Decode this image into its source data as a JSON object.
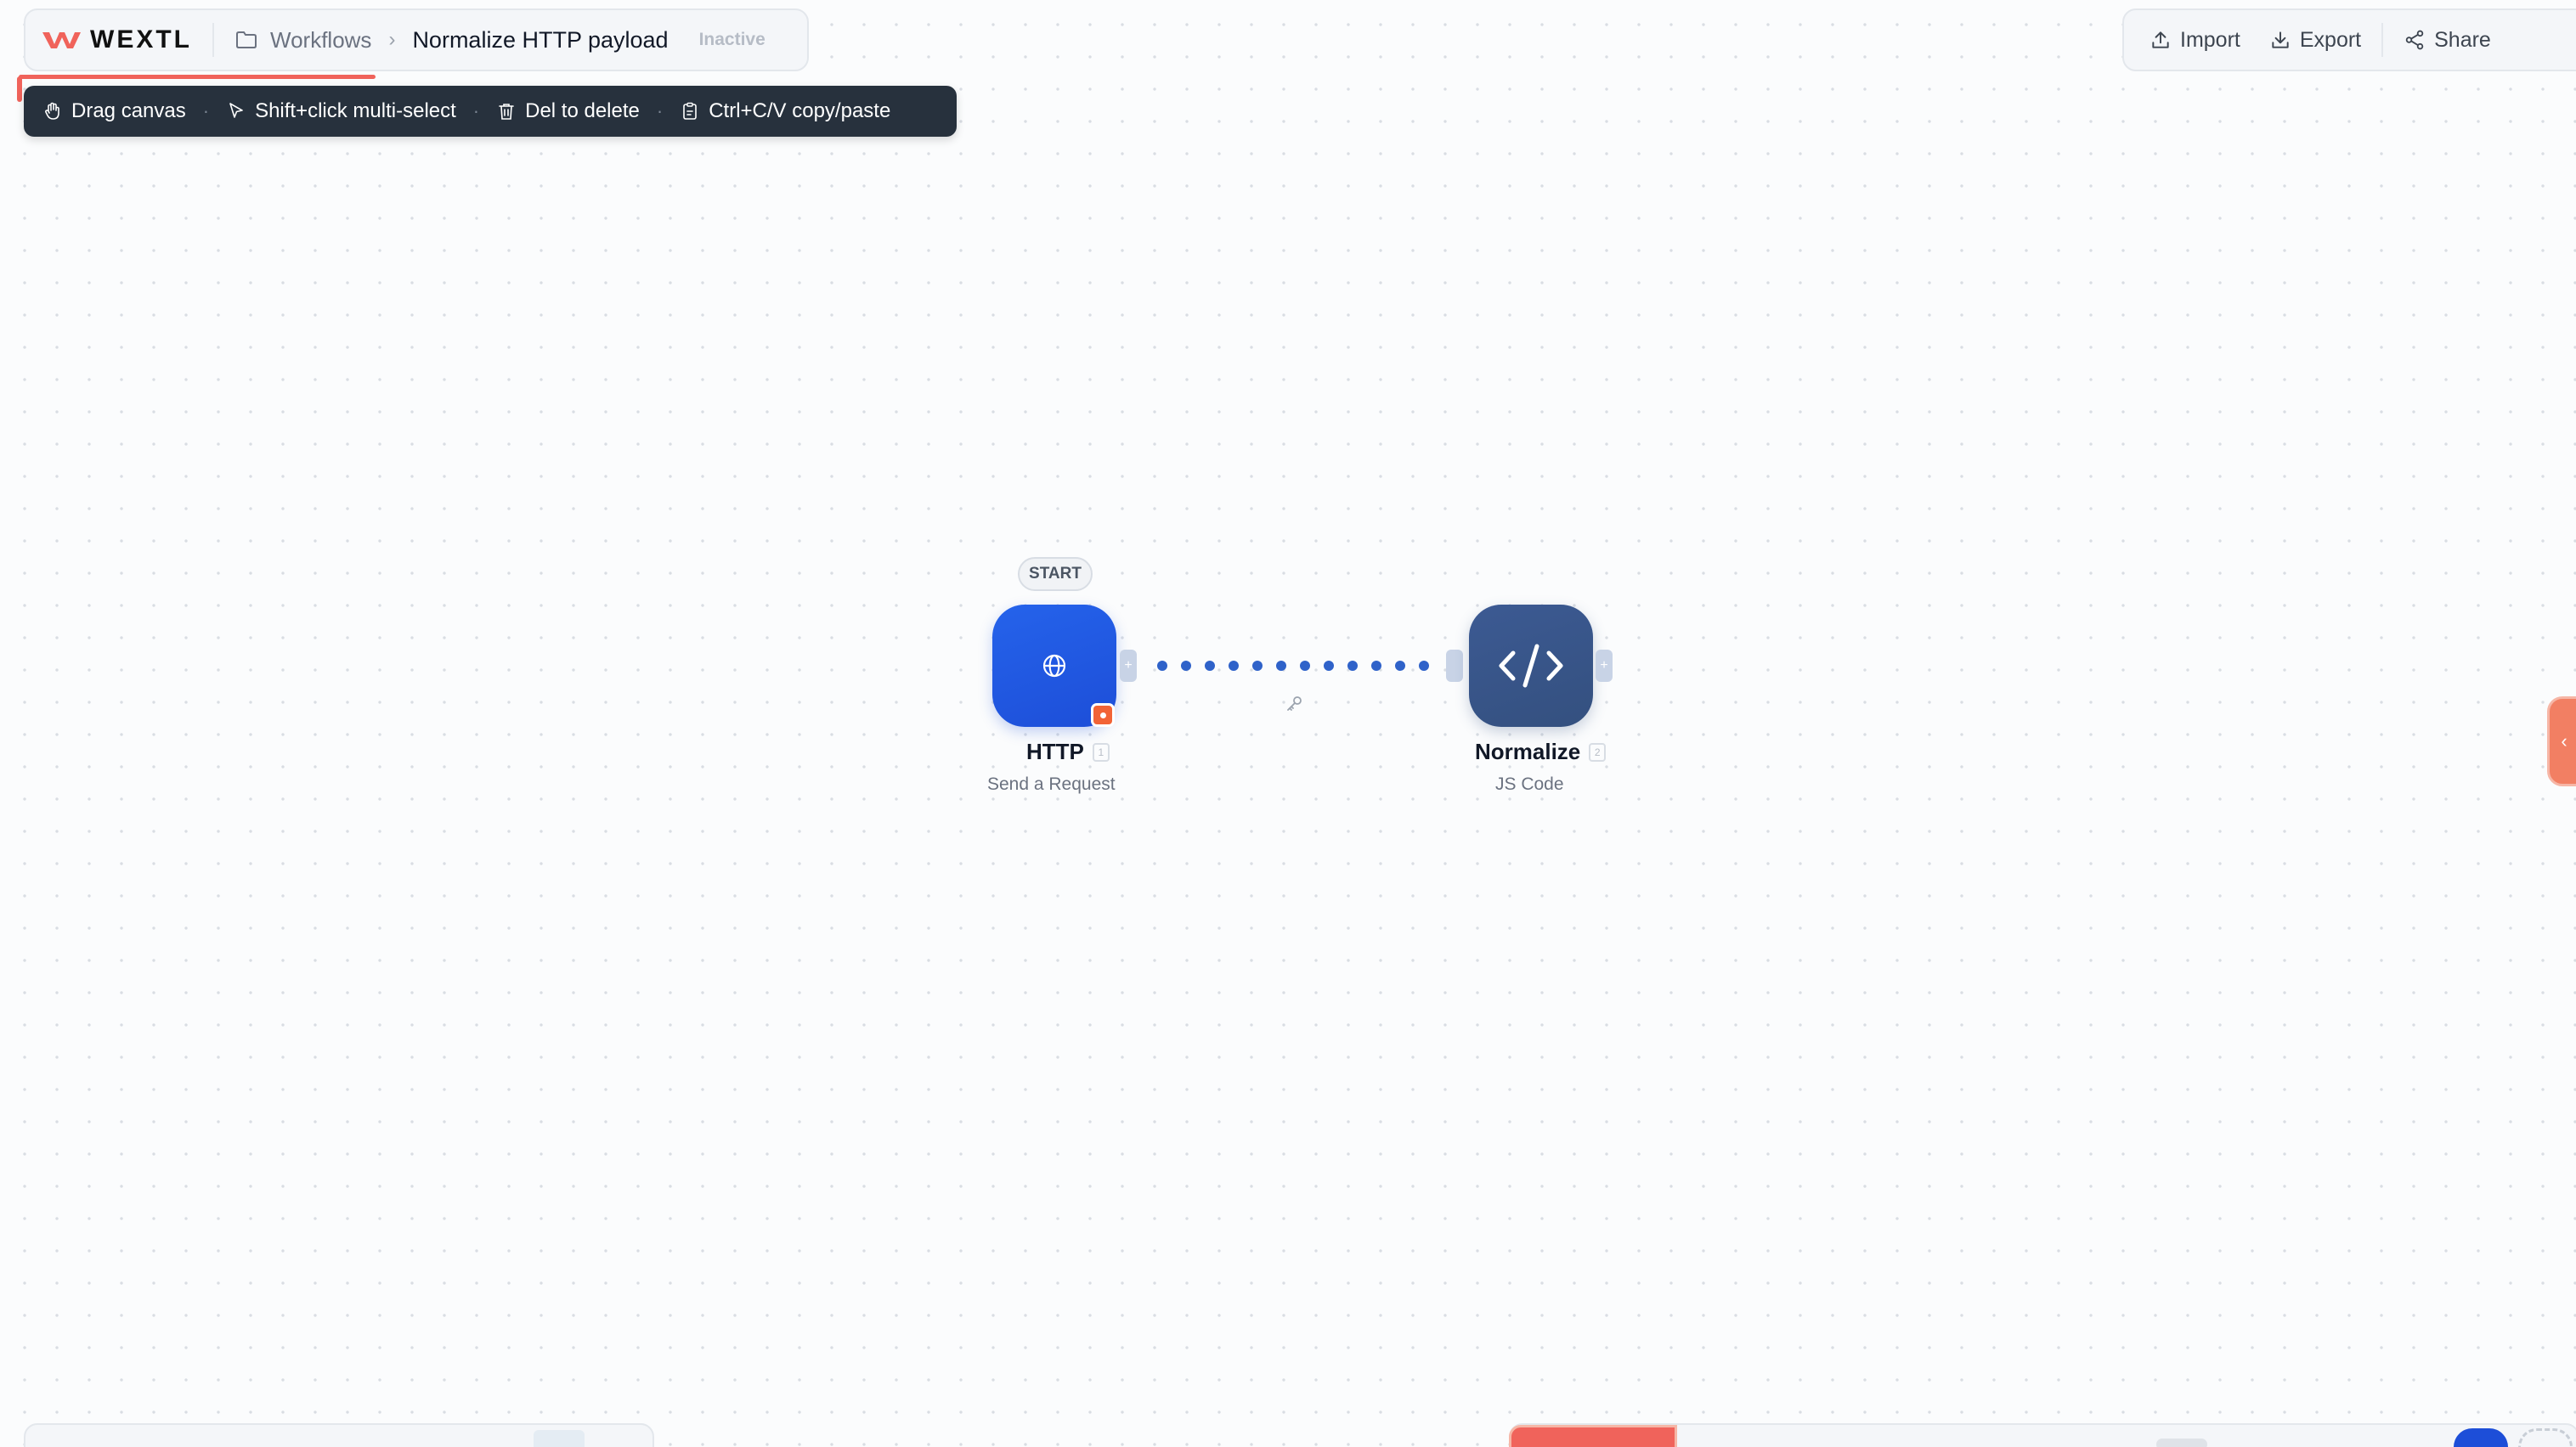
{
  "app": {
    "brand": "WEXTL"
  },
  "breadcrumb": {
    "section": "Workflows",
    "separator": "›",
    "title": "Normalize HTTP payload",
    "status": "Inactive"
  },
  "hints": [
    {
      "icon": "hand-icon",
      "label": "Drag canvas"
    },
    {
      "icon": "cursor-icon",
      "label": "Shift+click multi-select"
    },
    {
      "icon": "trash-icon",
      "label": "Del to delete"
    },
    {
      "icon": "clipboard-icon",
      "label": "Ctrl+C/V copy/paste"
    }
  ],
  "toolbar": {
    "import_label": "Import",
    "export_label": "Export",
    "share_label": "Share"
  },
  "canvas": {
    "start_badge": "START",
    "nodes": [
      {
        "id": "http",
        "label": "HTTP",
        "index": "1",
        "subtitle": "Send a Request",
        "icon": "globe-icon",
        "color": "#2563eb",
        "has_error": true
      },
      {
        "id": "normalize",
        "label": "Normalize",
        "index": "2",
        "subtitle": "JS Code",
        "icon": "code-icon",
        "color": "#3c5a93",
        "has_error": false
      }
    ],
    "edge": {
      "from": "http",
      "to": "normalize",
      "style": "dotted",
      "color": "#2f62c9"
    }
  },
  "colors": {
    "accent": "#f0635b",
    "dark_bar": "#27313d",
    "primary": "#1d4ed8"
  }
}
